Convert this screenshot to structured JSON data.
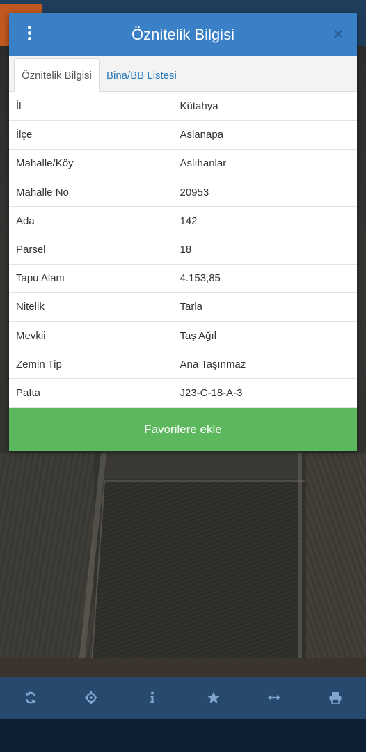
{
  "dialog": {
    "title": "Öznitelik Bilgisi",
    "close_label": "×",
    "tabs": [
      {
        "label": "Öznitelik Bilgisi",
        "active": true
      },
      {
        "label": "Bina/BB Listesi",
        "active": false
      }
    ],
    "rows": [
      {
        "key": "İl",
        "value": "Kütahya"
      },
      {
        "key": "İlçe",
        "value": "Aslanapa"
      },
      {
        "key": "Mahalle/Köy",
        "value": "Aslıhanlar"
      },
      {
        "key": "Mahalle No",
        "value": "20953"
      },
      {
        "key": "Ada",
        "value": "142"
      },
      {
        "key": "Parsel",
        "value": "18"
      },
      {
        "key": "Tapu Alanı",
        "value": "4.153,85"
      },
      {
        "key": "Nitelik",
        "value": "Tarla"
      },
      {
        "key": "Mevkii",
        "value": "Taş Ağıl"
      },
      {
        "key": "Zemin Tip",
        "value": "Ana Taşınmaz"
      },
      {
        "key": "Pafta",
        "value": "J23-C-18-A-3"
      }
    ],
    "favorite_button": "Favorilere ekle"
  },
  "toolbar": {
    "icons": [
      "refresh-icon",
      "locate-icon",
      "info-icon",
      "star-icon",
      "measure-icon",
      "print-icon"
    ]
  },
  "colors": {
    "header": "#3a80c6",
    "toolbar": "#27496e",
    "favorite": "#5cb85c",
    "tab_link": "#2a7bbd"
  }
}
